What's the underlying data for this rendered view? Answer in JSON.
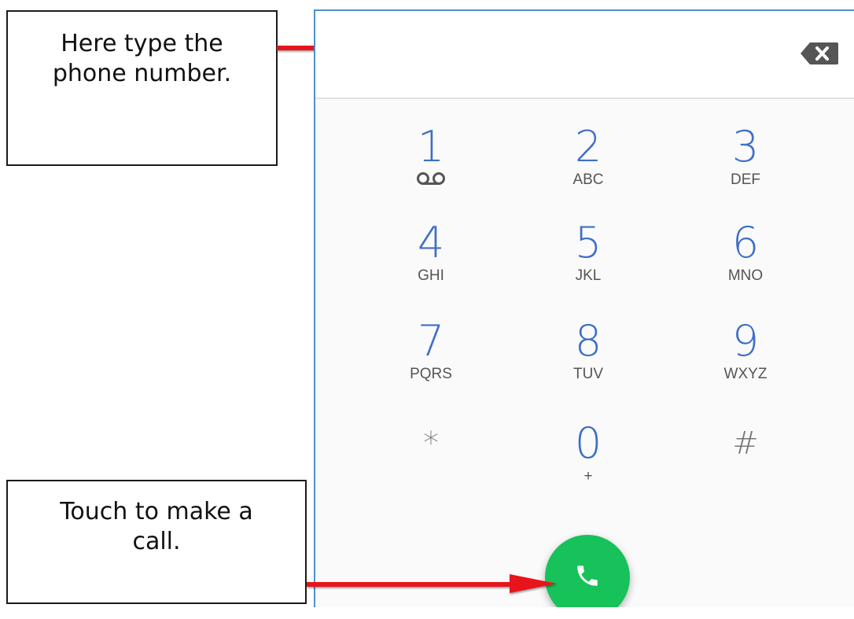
{
  "annotations": {
    "number_callout": "Here type the\nphone number.",
    "call_callout": "Touch to make a\ncall."
  },
  "dialer": {
    "number_value": "",
    "keys": [
      {
        "digit": "1",
        "letters": "",
        "icon": "voicemail-icon"
      },
      {
        "digit": "2",
        "letters": "ABC"
      },
      {
        "digit": "3",
        "letters": "DEF"
      },
      {
        "digit": "4",
        "letters": "GHI"
      },
      {
        "digit": "5",
        "letters": "JKL"
      },
      {
        "digit": "6",
        "letters": "MNO"
      },
      {
        "digit": "7",
        "letters": "PQRS"
      },
      {
        "digit": "8",
        "letters": "TUV"
      },
      {
        "digit": "9",
        "letters": "WXYZ"
      },
      {
        "digit": "*",
        "letters": ""
      },
      {
        "digit": "0",
        "letters": "+"
      },
      {
        "digit": "#",
        "letters": ""
      }
    ],
    "backspace_icon": "backspace-icon",
    "call_icon": "phone-icon"
  },
  "colors": {
    "digit": "#3d6ec9",
    "call_button": "#16c259",
    "arrow": "#e8141b",
    "frame_border": "#4f8fcc"
  }
}
